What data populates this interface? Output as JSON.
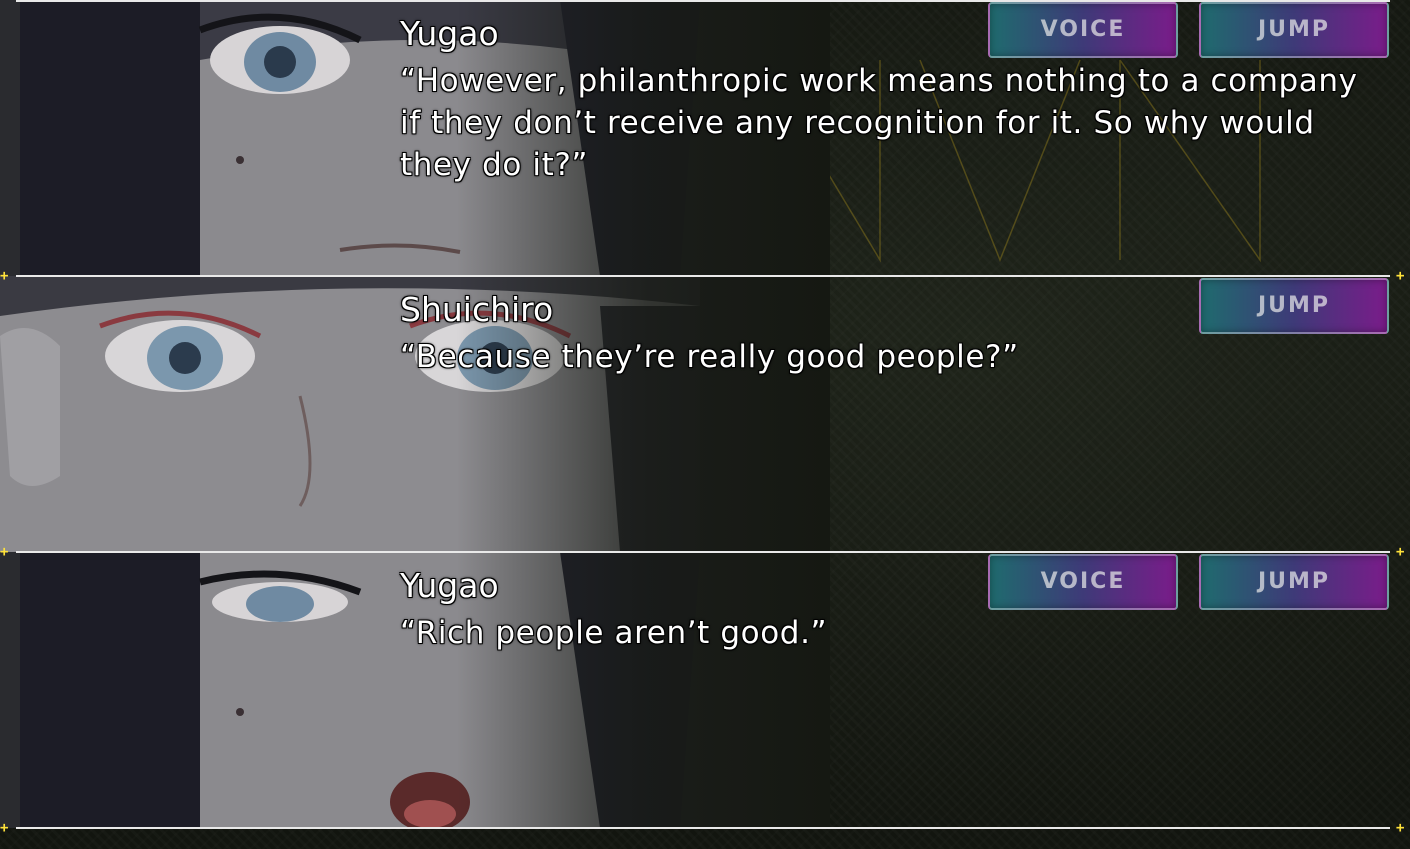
{
  "history": {
    "entries": [
      {
        "speaker": "Yugao",
        "text": "“However, philanthropic work means nothing to a company if they don’t receive any recognition for it. So why would they do it?”",
        "voice_label": "VOICE",
        "jump_label": "JUMP"
      },
      {
        "speaker": "Shuichiro",
        "text": "“Because they’re really good people?”",
        "jump_label": "JUMP"
      },
      {
        "speaker": "Yugao",
        "text": "“Rich people aren’t good.”",
        "voice_label": "VOICE",
        "jump_label": "JUMP"
      }
    ]
  },
  "theme": {
    "accent": "#ffe23a",
    "button_gradient_start": "#1f6b6e",
    "button_gradient_end": "#7a1c8a",
    "divider": "#e9e9e9"
  }
}
